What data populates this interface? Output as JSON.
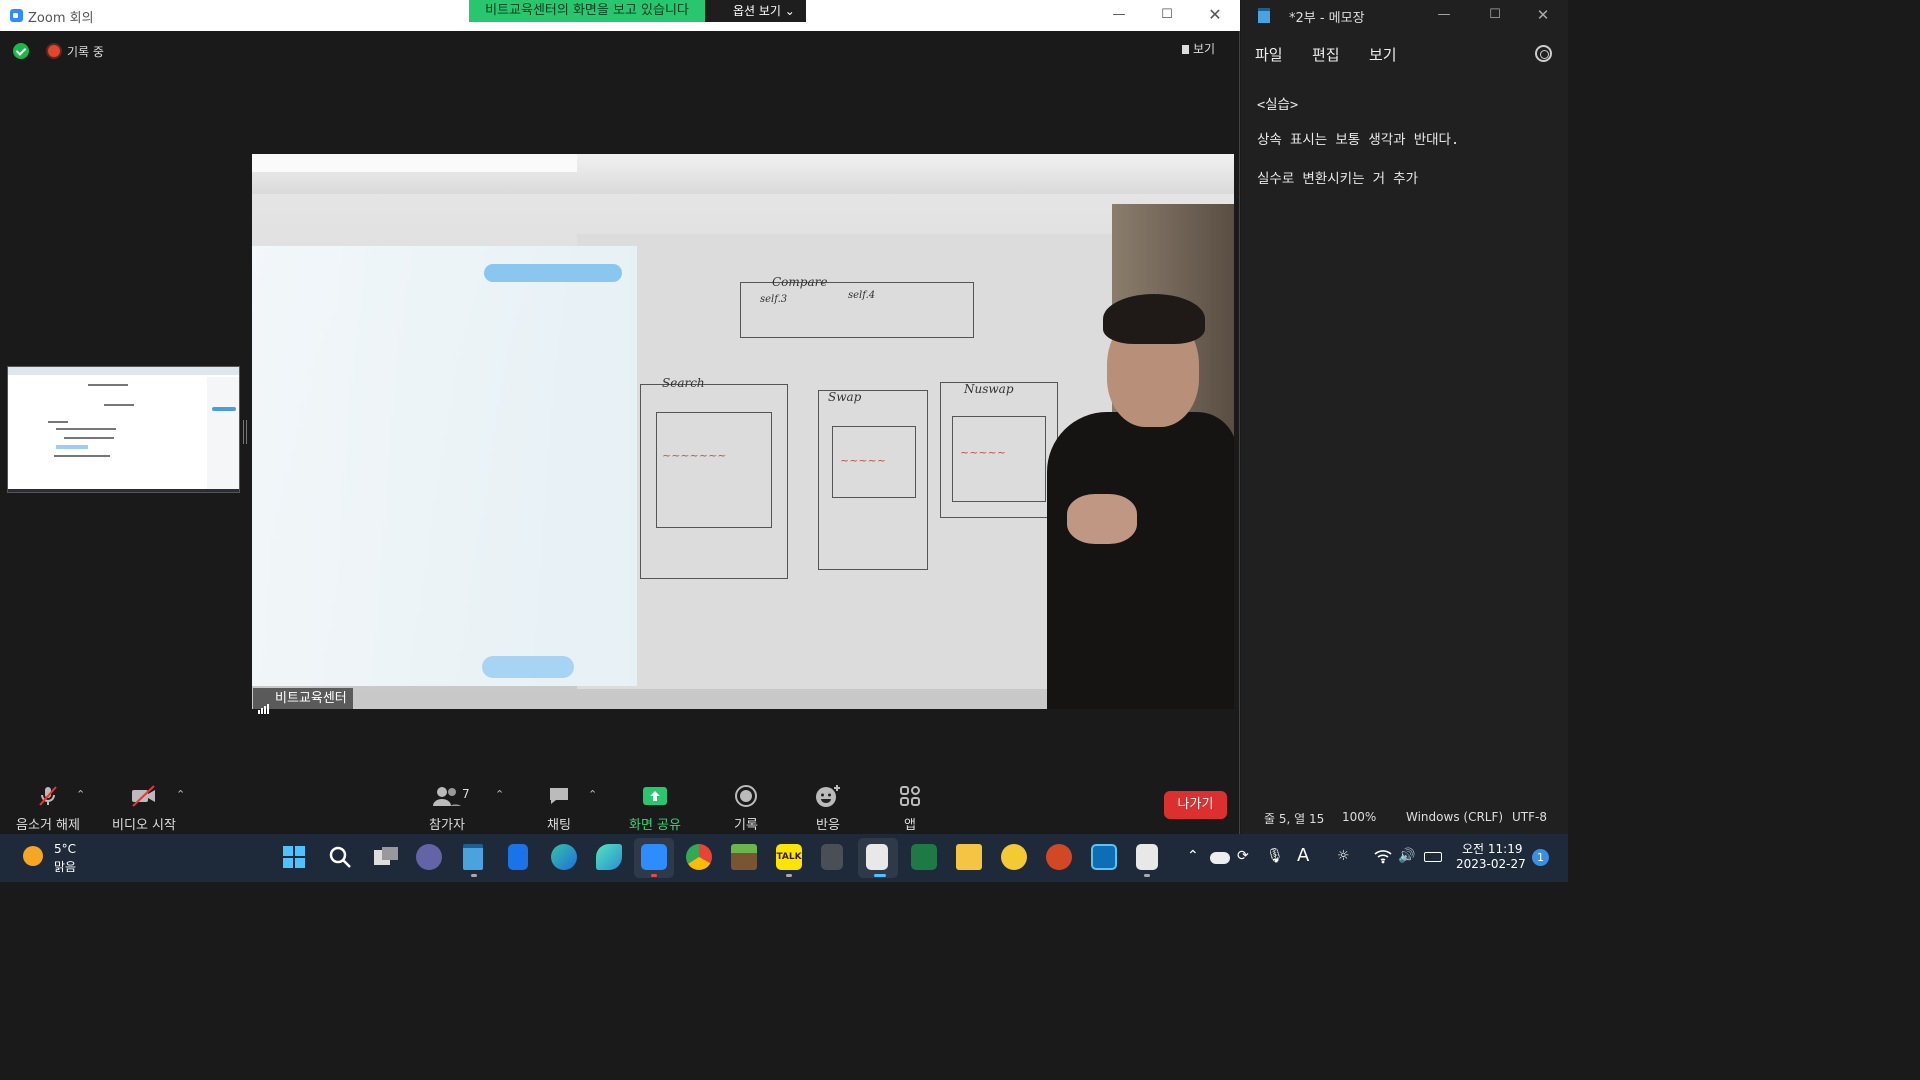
{
  "zoom": {
    "window_title": "Zoom 회의",
    "viewing_banner": "비트교육센터의 화면을 보고 있습니다",
    "view_options": "옵션 보기 ⌄",
    "recording_label": "기록 중",
    "view_button": "보기",
    "participant_name": "비트교육센터",
    "toolbar": {
      "unmute": "음소거 해제",
      "start_video": "비디오 시작",
      "participants": "참가자",
      "participant_count": "7",
      "chat": "채팅",
      "share_screen": "화면 공유",
      "record": "기록",
      "reactions": "반응",
      "apps": "앱",
      "leave": "나가기"
    },
    "whiteboard": {
      "compare": "Compare",
      "self1": "self.3",
      "self2": "self.4",
      "search": "Search",
      "swap": "Swap",
      "nuswap": "Nuswap"
    },
    "colors": {
      "share_green": "#37d67a",
      "leave_red": "#dc2f2f",
      "banner_green": "#28c76f"
    }
  },
  "notepad": {
    "window_title": "*2부 - 메모장",
    "menu": [
      "파일",
      "편집",
      "보기"
    ],
    "lines": [
      "<실습>",
      "상속 표시는 보통 생각과 반대다.",
      "실수로 변환시키는 거 추가"
    ],
    "status": {
      "position": "줄 5, 열 15",
      "zoom": "100%",
      "line_ending": "Windows (CRLF)",
      "encoding": "UTF-8"
    }
  },
  "taskbar": {
    "weather_temp": "5°C",
    "weather_desc": "맑음",
    "clock_time": "오전 11:19",
    "clock_date": "2023-02-27",
    "notifications": "1",
    "apps": [
      "start-icon",
      "search-icon",
      "task-view-icon",
      "teams-chat-icon",
      "notepad-icon",
      "lock-app-icon",
      "edge-icon",
      "swift-icon",
      "zoom-icon",
      "chrome-icon",
      "minecraft-icon",
      "kakaotalk-icon",
      "calculator-icon",
      "snipping-icon",
      "excel-icon",
      "file-explorer-icon",
      "wavve-icon",
      "powerpoint-icon",
      "dictionary-icon",
      "paint-icon"
    ],
    "kakao_label": "TALK"
  }
}
